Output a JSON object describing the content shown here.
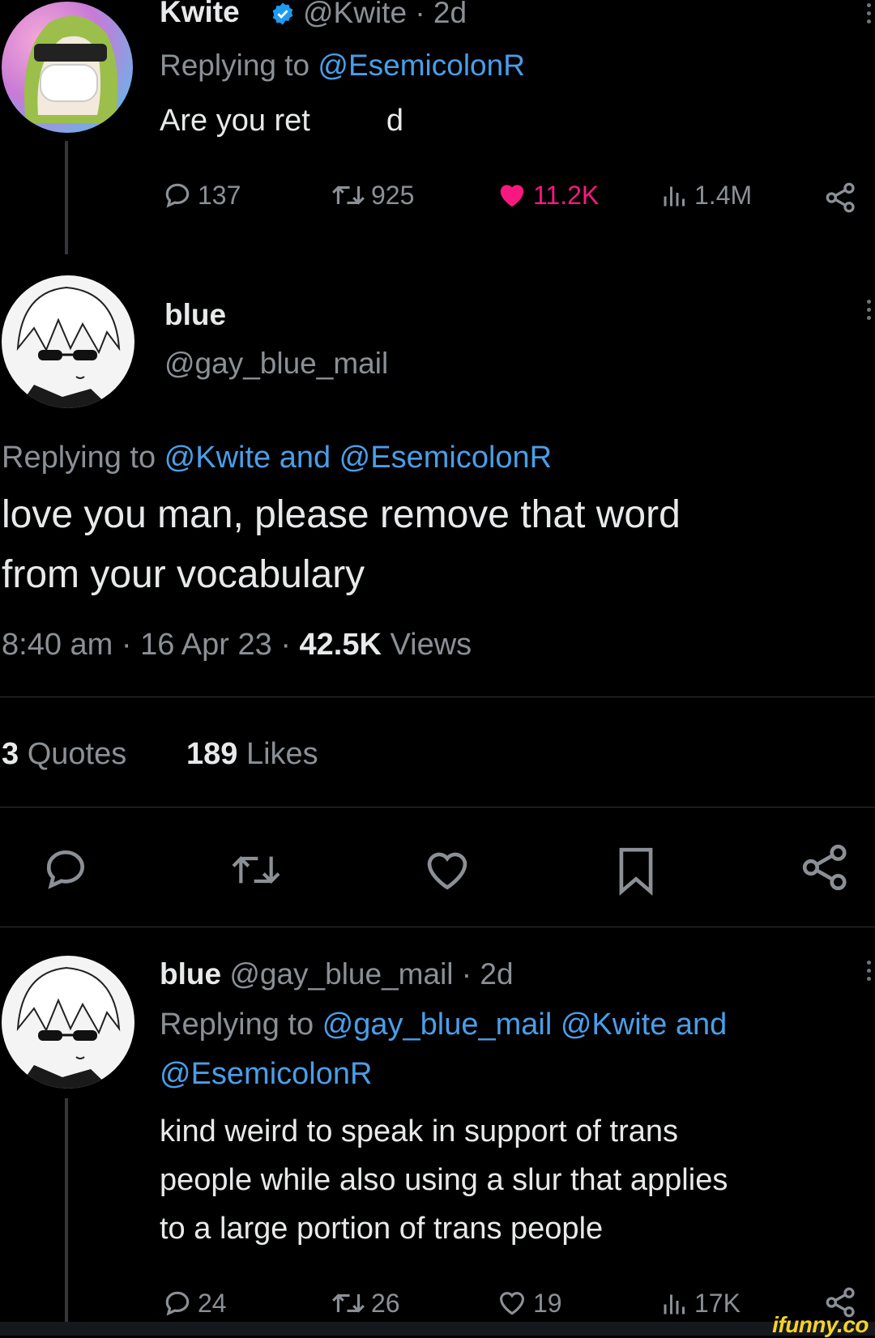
{
  "tweet1": {
    "display_name": "Kwite",
    "handle_time": "@Kwite · 2d",
    "replying_prefix": "Replying to ",
    "replying_handle": "@EsemicolonR",
    "text_a": "Are you ret",
    "text_b": "d",
    "stats": {
      "replies": "137",
      "retweets": "925",
      "likes": "11.2K",
      "views": "1.4M"
    }
  },
  "tweet2": {
    "display_name": "blue",
    "handle": "@gay_blue_mail",
    "replying_prefix": "Replying to ",
    "replying_handles": "@Kwite and @EsemicolonR",
    "text_line1": "love you man, please remove that word",
    "text_line2": "from your vocabulary",
    "time_date": "8:40 am · 16 Apr 23 · ",
    "views_count": "42.5K",
    "views_label": " Views",
    "quotes_count": "3",
    "quotes_label": " Quotes",
    "likes_count": "189",
    "likes_label": " Likes"
  },
  "tweet3": {
    "display_name": "blue",
    "handle_time": "@gay_blue_mail · 2d",
    "replying_prefix": "Replying to ",
    "replying_line1": "@gay_blue_mail @Kwite and",
    "replying_line2": "@EsemicolonR",
    "text_line1": "kind weird to speak in support of trans",
    "text_line2": "people while also using a slur that applies",
    "text_line3": "to a large portion of trans people",
    "stats": {
      "replies": "24",
      "retweets": "26",
      "likes": "19",
      "views": "17K"
    }
  },
  "watermark": "ifunny.co",
  "colors": {
    "background": "#000000",
    "text": "#e7e9ea",
    "secondary": "#8b9096",
    "link": "#4a9ee8",
    "like": "#f91880",
    "verified": "#1d9bf0"
  },
  "icons": [
    "reply-icon",
    "retweet-icon",
    "heart-icon",
    "views-icon",
    "share-icon",
    "bookmark-icon",
    "verified-badge-icon"
  ]
}
